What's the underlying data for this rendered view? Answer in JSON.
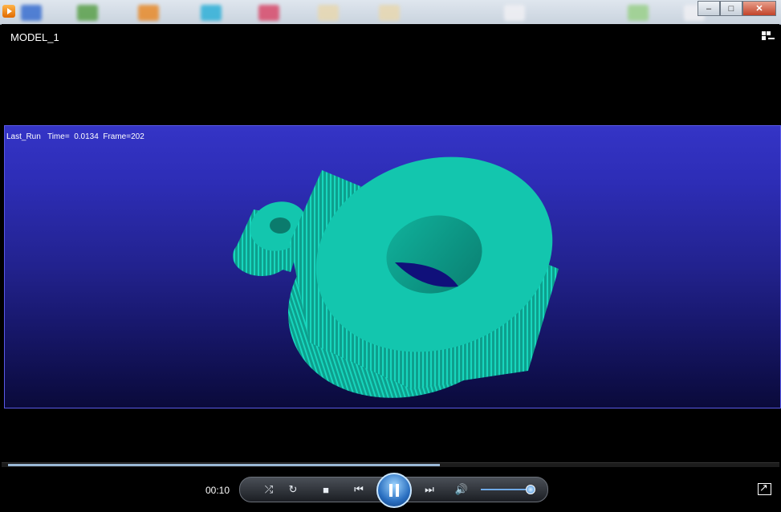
{
  "window": {
    "minimize_label": "–",
    "maximize_label": "□",
    "close_label": "✕"
  },
  "player": {
    "model_title": "MODEL_1",
    "run_info": "Last_Run   Time=  0.0134  Frame=202",
    "elapsed_time": "00:10",
    "progress": 0.56,
    "volume": 0.95
  },
  "colors": {
    "gear": "#13c6ae",
    "gear_dark": "#0c8f80",
    "viewport_top": "#3434c6",
    "viewport_bottom": "#0a0a3a",
    "accent": "#2a6fc0"
  },
  "icons": {
    "app": "media-player-icon",
    "switch_view": "switch-to-library-icon",
    "shuffle": "shuffle-icon",
    "repeat": "repeat-icon",
    "stop": "stop-icon",
    "previous": "previous-icon",
    "play_pause": "pause-icon",
    "next": "next-icon",
    "mute": "volume-icon",
    "fullscreen": "fullscreen-icon"
  }
}
